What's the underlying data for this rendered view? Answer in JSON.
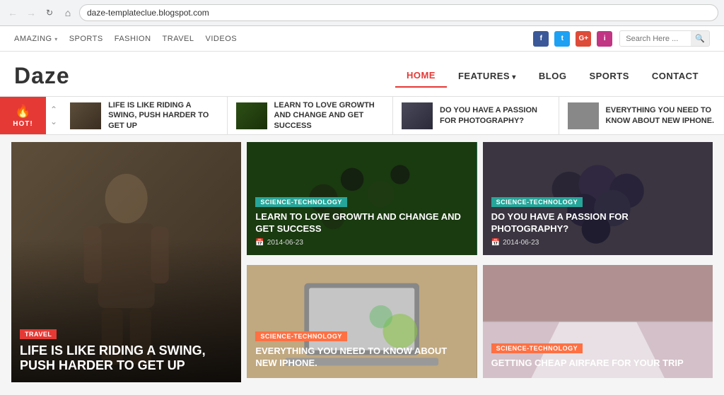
{
  "browser": {
    "url": "daze-templateclue.blogspot.com",
    "back_disabled": true,
    "forward_disabled": true
  },
  "utility_nav": {
    "items": [
      {
        "label": "AMAZING",
        "dropdown": true
      },
      {
        "label": "SPORTS",
        "dropdown": false
      },
      {
        "label": "FASHION",
        "dropdown": false
      },
      {
        "label": "TRAVEL",
        "dropdown": false
      },
      {
        "label": "VIDEOS",
        "dropdown": false
      }
    ],
    "search_placeholder": "Search Here ..."
  },
  "social": {
    "facebook": "f",
    "twitter": "t",
    "googleplus": "G+",
    "instagram": "i"
  },
  "header": {
    "logo": "Daze",
    "nav_items": [
      {
        "label": "HOME",
        "active": true,
        "dropdown": false
      },
      {
        "label": "FEATURES",
        "active": false,
        "dropdown": true
      },
      {
        "label": "BLOG",
        "active": false,
        "dropdown": false
      },
      {
        "label": "SPORTS",
        "active": false,
        "dropdown": false
      },
      {
        "label": "CONTACT",
        "active": false,
        "dropdown": false
      }
    ]
  },
  "ticker": {
    "hot_label": "HOT!",
    "items": [
      {
        "title": "LIFE IS LIKE RIDING A SWING, PUSH HARDER TO GET UP"
      },
      {
        "title": "LEARN TO LOVE GROWTH AND CHANGE AND GET SUCCESS"
      },
      {
        "title": "DO YOU HAVE A PASSION FOR PHOTOGRAPHY?"
      },
      {
        "title": "EVERYTHING YOU NEED TO KNOW ABOUT NEW IPHONE."
      }
    ]
  },
  "featured_card": {
    "tag": "TRAVEL",
    "title": "LIFE IS LIKE RIDING A SWING, PUSH HARDER TO GET UP"
  },
  "cards": [
    {
      "tag": "SCIENCE-TECHNOLOGY",
      "tag_type": "sci-tech",
      "title": "LEARN TO LOVE GROWTH AND CHANGE AND GET SUCCESS",
      "date": "2014-06-23"
    },
    {
      "tag": "SCIENCE-TECHNOLOGY",
      "tag_type": "sci-tech",
      "title": "DO YOU HAVE A PASSION FOR PHOTOGRAPHY?",
      "date": "2014-06-23"
    },
    {
      "tag": "SCIENCE-TECHNOLOGY",
      "tag_type": "sci-tech-orange",
      "title": "EVERYTHING YOU NEED TO KNOW ABOUT NEW IPHONE.",
      "date": ""
    },
    {
      "tag": "SCIENCE-TECHNOLOGY",
      "tag_type": "sci-tech-orange",
      "title": "GETTING CHEAP AIRFARE FOR YOUR TRIP",
      "date": ""
    }
  ]
}
